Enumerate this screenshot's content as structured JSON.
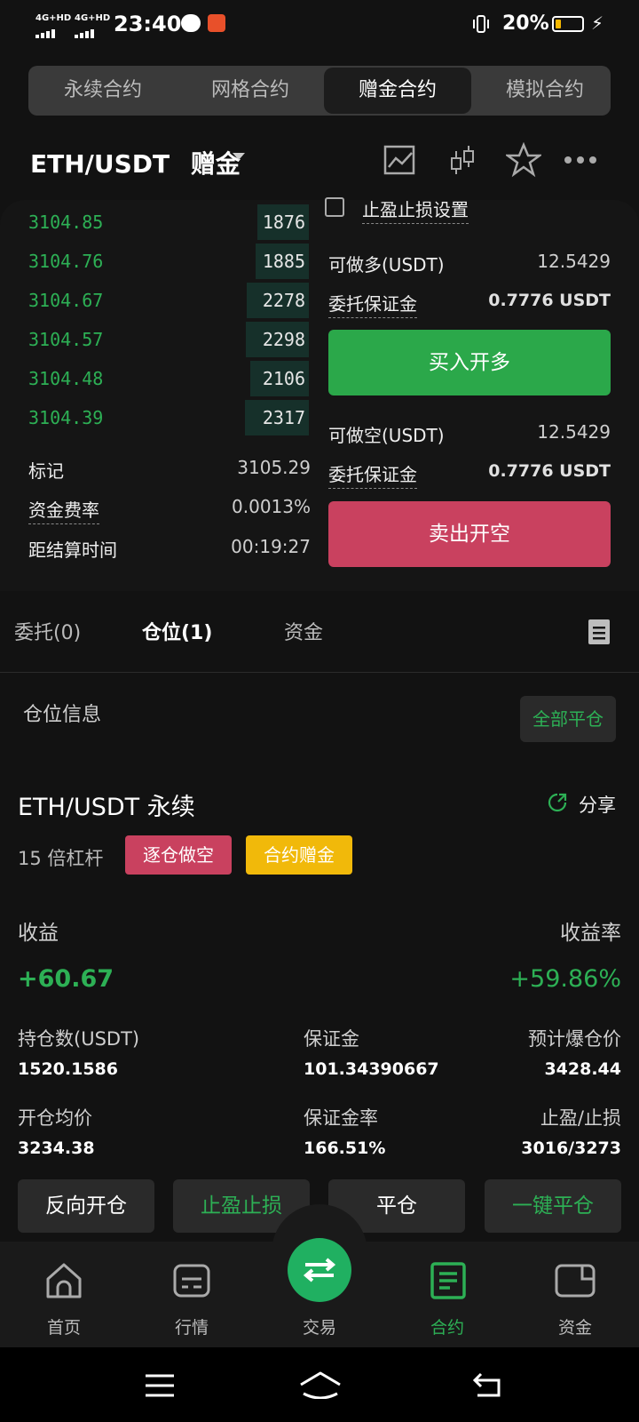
{
  "status": {
    "net1": "4G+HD",
    "net2": "4G+HD",
    "time": "23:40",
    "battery": "20%",
    "battery_level": 0.2
  },
  "tabs": [
    "永续合约",
    "网格合约",
    "赠金合约",
    "模拟合约"
  ],
  "tabs_active": 2,
  "header": {
    "pair": "ETH/USDT",
    "type": "赠金"
  },
  "orderbook": {
    "rows": [
      {
        "price": "3104.85",
        "qty": "1876"
      },
      {
        "price": "3104.76",
        "qty": "1885"
      },
      {
        "price": "3104.67",
        "qty": "2278"
      },
      {
        "price": "3104.57",
        "qty": "2298"
      },
      {
        "price": "3104.48",
        "qty": "2106"
      },
      {
        "price": "3104.39",
        "qty": "2317"
      }
    ],
    "mark_label": "标记",
    "mark_value": "3105.29",
    "funding_label": "资金费率",
    "funding_value": "0.0013%",
    "settle_label": "距结算时间",
    "settle_value": "00:19:27"
  },
  "order_form": {
    "tpsl_label": "止盈止损设置",
    "long_avail_label": "可做多(USDT)",
    "long_avail_value": "12.5429",
    "long_margin_label": "委托保证金",
    "long_margin_value": "0.7776 USDT",
    "long_button": "买入开多",
    "short_avail_label": "可做空(USDT)",
    "short_avail_value": "12.5429",
    "short_margin_label": "委托保证金",
    "short_margin_value": "0.7776 USDT",
    "short_button": "卖出开空"
  },
  "subtabs": [
    "委托(0)",
    "仓位(1)",
    "资金"
  ],
  "subtabs_active": 1,
  "position": {
    "section_title": "仓位信息",
    "close_all": "全部平仓",
    "title": "ETH/USDT 永续",
    "share": "分享",
    "leverage": "15 倍杠杆",
    "side_badge": "逐仓做空",
    "bonus_badge": "合约赠金",
    "pnl_label": "收益",
    "pnl_rate_label": "收益率",
    "pnl_value": "+60.67",
    "pnl_rate_value": "+59.86%",
    "fields": [
      {
        "label": "持仓数(USDT)",
        "value": "1520.1586"
      },
      {
        "label": "保证金",
        "value": "101.34390667"
      },
      {
        "label": "预计爆仓价",
        "value": "3428.44"
      },
      {
        "label": "开仓均价",
        "value": "3234.38"
      },
      {
        "label": "保证金率",
        "value": "166.51%"
      },
      {
        "label": "止盈/止损",
        "value": "3016/3273"
      }
    ],
    "actions": [
      "反向开仓",
      "止盈止损",
      "平仓",
      "一键平仓"
    ]
  },
  "nav": {
    "items": [
      "首页",
      "行情",
      "交易",
      "合约",
      "资金"
    ],
    "active": 3
  },
  "colors": {
    "green": "#2db055",
    "red": "#c9415f",
    "yellow": "#f1b90a",
    "background": "#121212"
  }
}
